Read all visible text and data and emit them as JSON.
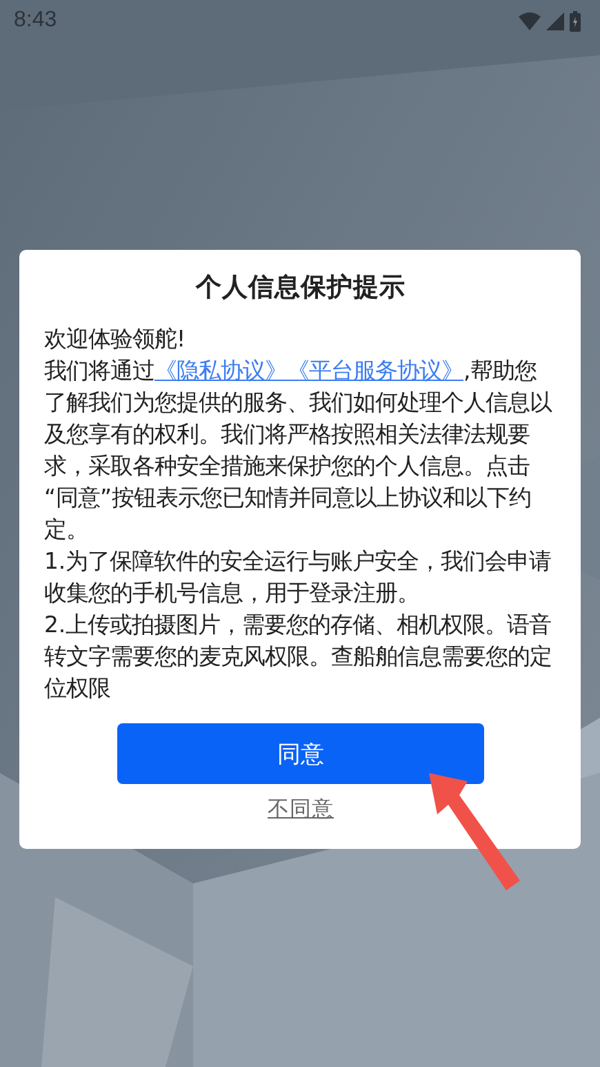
{
  "status_bar": {
    "time": "8:43"
  },
  "dialog": {
    "title": "个人信息保护提示",
    "paragraphs": [
      {
        "kind": "plain",
        "text": "欢迎体验领舵!"
      },
      {
        "kind": "links",
        "before": "我们将通过",
        "links": [
          "《隐私协议》",
          "《平台服务协议》"
        ],
        "after": ",帮助您了解我们为您提供的服务、我们如何处理个人信息以及您享有的权利。我们将严格按照相关法律法规要求，采取各种安全措施来保护您的个人信息。点击 “同意”按钮表示您已知情并同意以上协议和以下约定。"
      },
      {
        "kind": "plain",
        "text": "1.为了保障软件的安全运行与账户安全，我们会申请收集您的手机号信息，用于登录注册。"
      },
      {
        "kind": "plain",
        "text": "2.上传或拍摄图片，需要您的存储、相机权限。语音转文字需要您的麦克风权限。查船舶信息需要您的定位权限"
      }
    ],
    "agree_button": "同意",
    "decline_link": "不同意"
  }
}
